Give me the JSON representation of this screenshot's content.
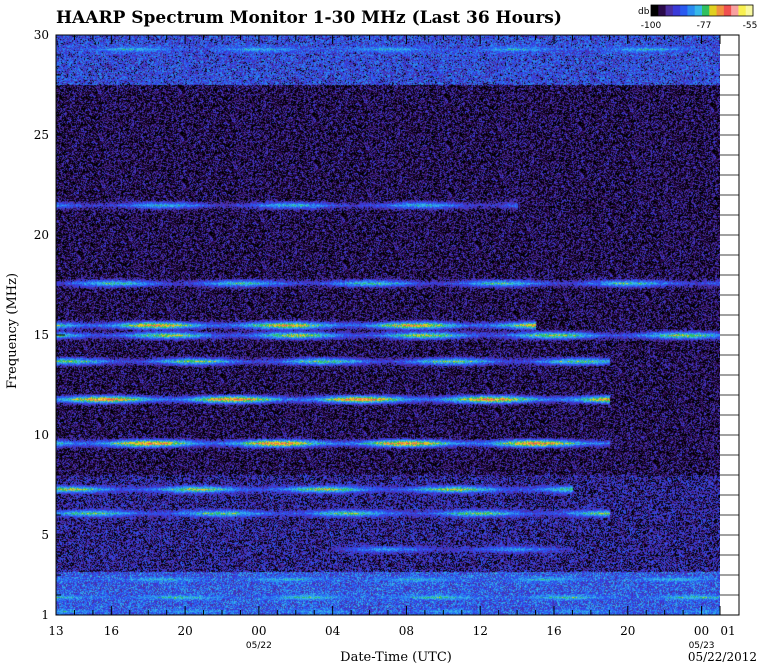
{
  "chart_data": {
    "type": "heatmap",
    "title": "HAARP Spectrum Monitor 1-30 MHz (Last 36 Hours)",
    "xlabel": "Date-Time (UTC)",
    "ylabel": "Frequency (MHz)",
    "ylim": [
      1,
      30
    ],
    "y_ticks": [
      "1",
      "5",
      "10",
      "15",
      "20",
      "25",
      "30"
    ],
    "x_ticks": [
      "13",
      "16",
      "20",
      "00",
      "04",
      "08",
      "12",
      "16",
      "20",
      "00",
      "01"
    ],
    "x_date_labels": [
      {
        "at_tick": 3,
        "label": "05/22"
      },
      {
        "at_tick": 9,
        "label": "05/23"
      }
    ],
    "date_stamp": "05/22/2012",
    "colorbar": {
      "label": "db",
      "tick_labels": [
        "-100",
        "-77",
        "-55"
      ],
      "colors": [
        "#000000",
        "#2a0a4a",
        "#4a2ea0",
        "#3a3ad8",
        "#2a5af0",
        "#2a8cf0",
        "#38b8e8",
        "#30c060",
        "#e0d020",
        "#f09040",
        "#f05050",
        "#f8a0a0",
        "#f8f050",
        "#f8f8a0"
      ]
    },
    "bands": [
      {
        "freq_mhz": 29.3,
        "intensity": 0.55,
        "x_hours": [
          0,
          36
        ]
      },
      {
        "freq_mhz": 21.5,
        "intensity": 0.55,
        "x_hours": [
          0,
          25
        ]
      },
      {
        "freq_mhz": 17.6,
        "intensity": 0.6,
        "x_hours": [
          0,
          36
        ]
      },
      {
        "freq_mhz": 15.5,
        "intensity": 0.8,
        "x_hours": [
          0,
          26
        ]
      },
      {
        "freq_mhz": 15.0,
        "intensity": 0.7,
        "x_hours": [
          0,
          36
        ]
      },
      {
        "freq_mhz": 13.7,
        "intensity": 0.65,
        "x_hours": [
          0,
          30
        ]
      },
      {
        "freq_mhz": 11.8,
        "intensity": 0.85,
        "x_hours": [
          0,
          30
        ]
      },
      {
        "freq_mhz": 9.6,
        "intensity": 0.85,
        "x_hours": [
          0,
          30
        ]
      },
      {
        "freq_mhz": 7.3,
        "intensity": 0.7,
        "x_hours": [
          0,
          28
        ]
      },
      {
        "freq_mhz": 6.1,
        "intensity": 0.65,
        "x_hours": [
          0,
          30
        ]
      },
      {
        "freq_mhz": 4.3,
        "intensity": 0.5,
        "x_hours": [
          15,
          28
        ]
      },
      {
        "freq_mhz": 2.8,
        "intensity": 0.55,
        "x_hours": [
          0,
          36
        ]
      },
      {
        "freq_mhz": 1.9,
        "intensity": 0.6,
        "x_hours": [
          0,
          36
        ]
      },
      {
        "freq_mhz": 1.2,
        "intensity": 0.5,
        "x_hours": [
          0,
          36
        ]
      }
    ]
  }
}
